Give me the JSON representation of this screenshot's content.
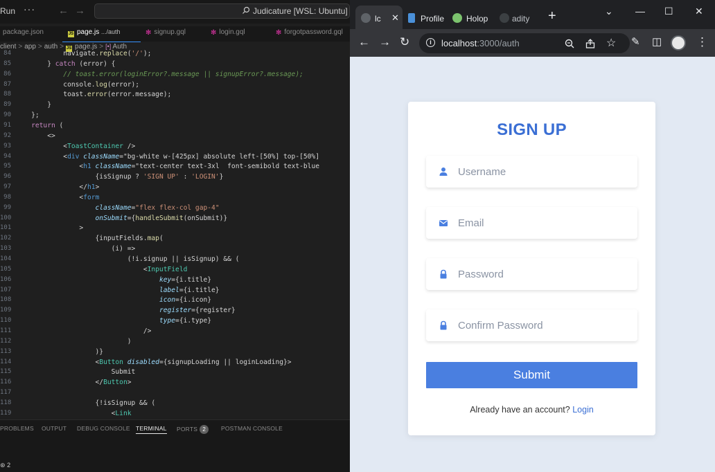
{
  "vscode": {
    "menu_label": "Run",
    "more_label": "···",
    "search_text": "Judicature [WSL: Ubuntu]",
    "tabs": [
      {
        "label": "package.json"
      },
      {
        "label": "page.js",
        "suffix": ".../auth"
      },
      {
        "label": "signup.gql"
      },
      {
        "label": "login.gql"
      },
      {
        "label": "forgotpassword.gql"
      }
    ],
    "breadcrumb": [
      "client",
      "app",
      "auth",
      "page.js",
      "Auth"
    ],
    "code_lines": [
      {
        "n": "84",
        "text": "            navigate.replace('/');"
      },
      {
        "n": "85",
        "text": "        } catch (error) {"
      },
      {
        "n": "86",
        "text": "            // toast.error(loginError?.message || signupError?.message);"
      },
      {
        "n": "87",
        "text": "            console.log(error);"
      },
      {
        "n": "88",
        "text": "            toast.error(error.message);"
      },
      {
        "n": "89",
        "text": "        }"
      },
      {
        "n": "90",
        "text": "    };"
      },
      {
        "n": "91",
        "text": "    return ("
      },
      {
        "n": "92",
        "text": "        <>"
      },
      {
        "n": "93",
        "text": "            <ToastContainer />"
      },
      {
        "n": "94",
        "text": "            <div className=\"bg-white w-[425px] absolute left-[50%] top-[50%]"
      },
      {
        "n": "95",
        "text": "                <h1 className=\"text-center text-3xl  font-semibold text-blue"
      },
      {
        "n": "96",
        "text": "                    {isSignup ? 'SIGN UP' : 'LOGIN'}"
      },
      {
        "n": "97",
        "text": "                </h1>"
      },
      {
        "n": "98",
        "text": "                <form"
      },
      {
        "n": "99",
        "text": "                    className=\"flex flex-col gap-4\""
      },
      {
        "n": "100",
        "text": "                    onSubmit={handleSubmit(onSubmit)}"
      },
      {
        "n": "101",
        "text": "                >"
      },
      {
        "n": "102",
        "text": "                    {inputFields.map("
      },
      {
        "n": "103",
        "text": "                        (i) =>"
      },
      {
        "n": "104",
        "text": "                            (!i.signup || isSignup) && ("
      },
      {
        "n": "105",
        "text": "                                <InputField"
      },
      {
        "n": "106",
        "text": "                                    key={i.title}"
      },
      {
        "n": "107",
        "text": "                                    label={i.title}"
      },
      {
        "n": "108",
        "text": "                                    icon={i.icon}"
      },
      {
        "n": "109",
        "text": "                                    register={register}"
      },
      {
        "n": "110",
        "text": "                                    type={i.type}"
      },
      {
        "n": "111",
        "text": "                                />"
      },
      {
        "n": "112",
        "text": "                            )"
      },
      {
        "n": "113",
        "text": "                    )}"
      },
      {
        "n": "114",
        "text": "                    <Button disabled={signupLoading || loginLoading}>"
      },
      {
        "n": "115",
        "text": "                        Submit"
      },
      {
        "n": "116",
        "text": "                    </Button>"
      },
      {
        "n": "117",
        "text": ""
      },
      {
        "n": "118",
        "text": "                    {!isSignup && ("
      },
      {
        "n": "119",
        "text": "                        <Link"
      }
    ],
    "panel_tabs": [
      "PROBLEMS",
      "OUTPUT",
      "DEBUG CONSOLE",
      "TERMINAL",
      "PORTS",
      "POSTMAN CONSOLE"
    ],
    "ports_count": "2",
    "status_text": "2"
  },
  "chrome": {
    "tabs": [
      {
        "label": "lc",
        "favicon_color": "#5f6368"
      },
      {
        "label": "Profile",
        "favicon_color": "#4a90d9"
      },
      {
        "label": "Holop",
        "favicon_color": "#7cc36e"
      },
      {
        "label": "adity",
        "favicon_color": "#3c4043"
      }
    ],
    "url_host": "localhost",
    "url_path": ":3000/auth",
    "new_tab_label": "+"
  },
  "page": {
    "title": "SIGN UP",
    "fields": [
      {
        "placeholder": "Username",
        "icon": "user-icon"
      },
      {
        "placeholder": "Email",
        "icon": "envelope-icon"
      },
      {
        "placeholder": "Password",
        "icon": "lock-icon"
      },
      {
        "placeholder": "Confirm Password",
        "icon": "lock-icon"
      }
    ],
    "submit_label": "Submit",
    "footer_text": "Already have an account?",
    "footer_link": "Login",
    "accent_color": "#4a7fe0"
  }
}
